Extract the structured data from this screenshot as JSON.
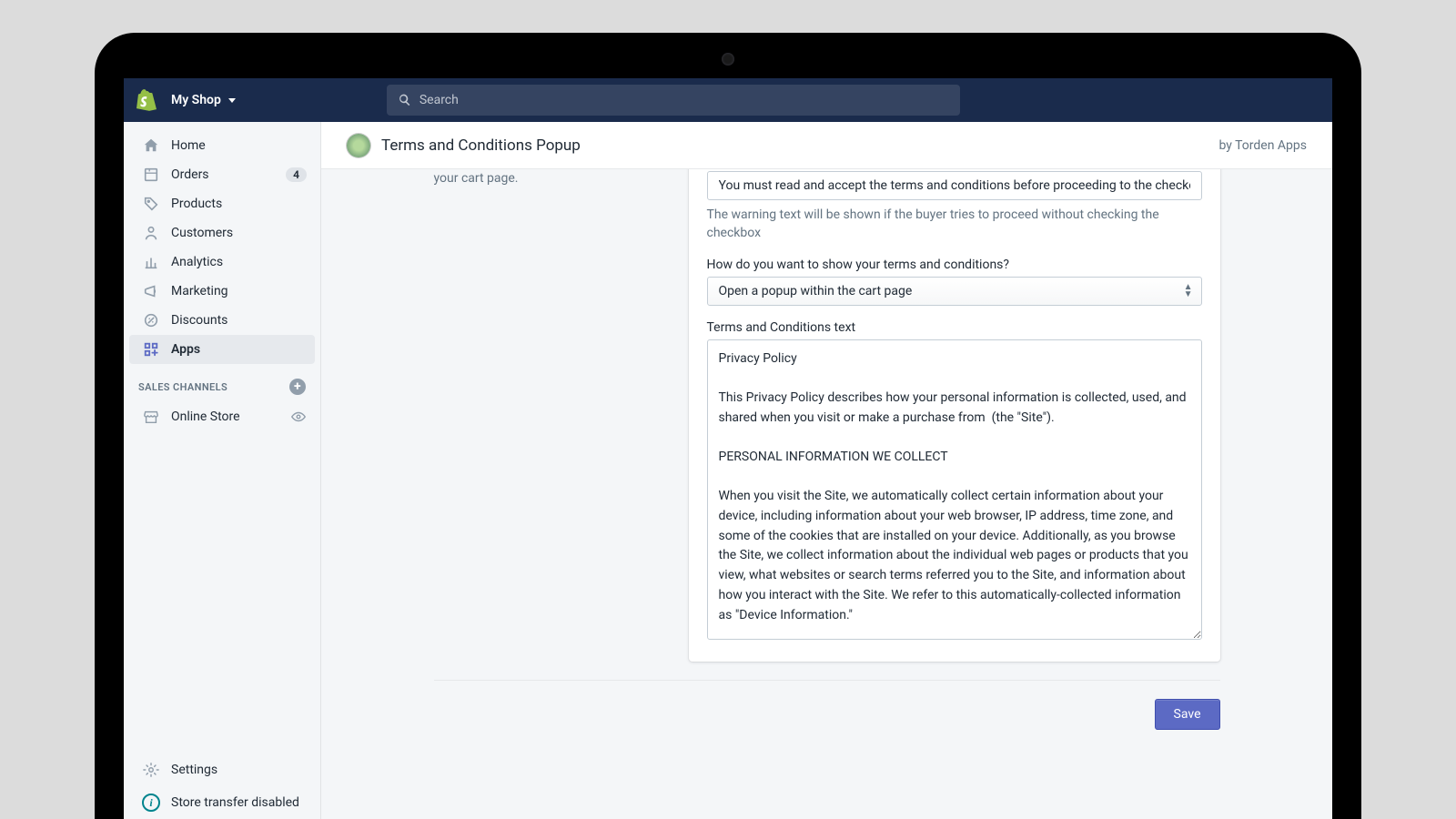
{
  "topbar": {
    "shop_name": "My Shop",
    "search_placeholder": "Search"
  },
  "sidebar": {
    "items": [
      {
        "label": "Home",
        "badge": null
      },
      {
        "label": "Orders",
        "badge": "4"
      },
      {
        "label": "Products",
        "badge": null
      },
      {
        "label": "Customers",
        "badge": null
      },
      {
        "label": "Analytics",
        "badge": null
      },
      {
        "label": "Marketing",
        "badge": null
      },
      {
        "label": "Discounts",
        "badge": null
      },
      {
        "label": "Apps",
        "badge": null
      }
    ],
    "sales_channels_heading": "SALES CHANNELS",
    "sales_channels": [
      {
        "label": "Online Store"
      }
    ],
    "settings_label": "Settings",
    "transfer_label": "Store transfer disabled"
  },
  "page": {
    "title": "Terms and Conditions Popup",
    "vendor_prefix": "by ",
    "vendor": "Torden Apps",
    "left_help": "your cart page.",
    "fields": {
      "warning_value": "You must read and accept the terms and conditions before proceeding to the checkout.",
      "warning_help": "The warning text will be shown if the buyer tries to proceed without checking the checkbox",
      "show_mode_label": "How do you want to show your terms and conditions?",
      "show_mode_value": "Open a popup within the cart page",
      "tc_label": "Terms and Conditions text",
      "tc_value": "Privacy Policy\n\nThis Privacy Policy describes how your personal information is collected, used, and shared when you visit or make a purchase from  (the \"Site\").\n\nPERSONAL INFORMATION WE COLLECT\n\nWhen you visit the Site, we automatically collect certain information about your device, including information about your web browser, IP address, time zone, and some of the cookies that are installed on your device. Additionally, as you browse the Site, we collect information about the individual web pages or products that you view, what websites or search terms referred you to the Site, and information about how you interact with the Site. We refer to this automatically-collected information as \"Device Information.\""
    },
    "save_label": "Save"
  }
}
